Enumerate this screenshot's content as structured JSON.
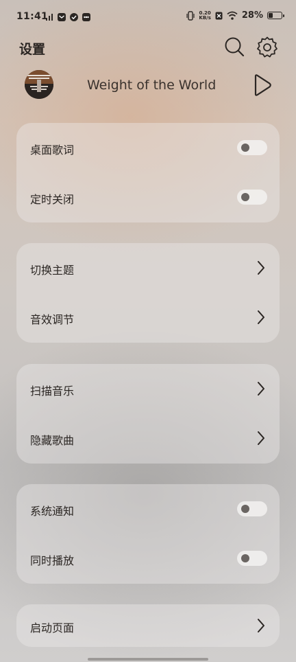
{
  "status_bar": {
    "time": "11:41",
    "net_speed_value": "0.20",
    "net_speed_unit": "KB/s",
    "battery_percent": "28%",
    "battery_level": 0.28
  },
  "header": {
    "title": "设置",
    "search_icon": "search-icon",
    "settings_icon": "gear-icon"
  },
  "now_playing": {
    "song_title": "Weight of the World",
    "play_icon": "play-icon"
  },
  "groups": [
    {
      "items": [
        {
          "label": "桌面歌词",
          "control": "toggle",
          "on": false
        },
        {
          "label": "定时关闭",
          "control": "toggle",
          "on": false
        }
      ]
    },
    {
      "items": [
        {
          "label": "切换主题",
          "control": "chevron"
        },
        {
          "label": "音效调节",
          "control": "chevron"
        }
      ]
    },
    {
      "items": [
        {
          "label": "扫描音乐",
          "control": "chevron"
        },
        {
          "label": "隐藏歌曲",
          "control": "chevron"
        }
      ]
    },
    {
      "items": [
        {
          "label": "系统通知",
          "control": "toggle",
          "on": false
        },
        {
          "label": "同时播放",
          "control": "toggle",
          "on": false
        }
      ]
    },
    {
      "items": [
        {
          "label": "启动页面",
          "control": "chevron"
        }
      ]
    }
  ],
  "colors": {
    "text": "#2b2623",
    "toggle_knob_off": "#6a6562",
    "toggle_track_off": "#f5f4f3"
  }
}
